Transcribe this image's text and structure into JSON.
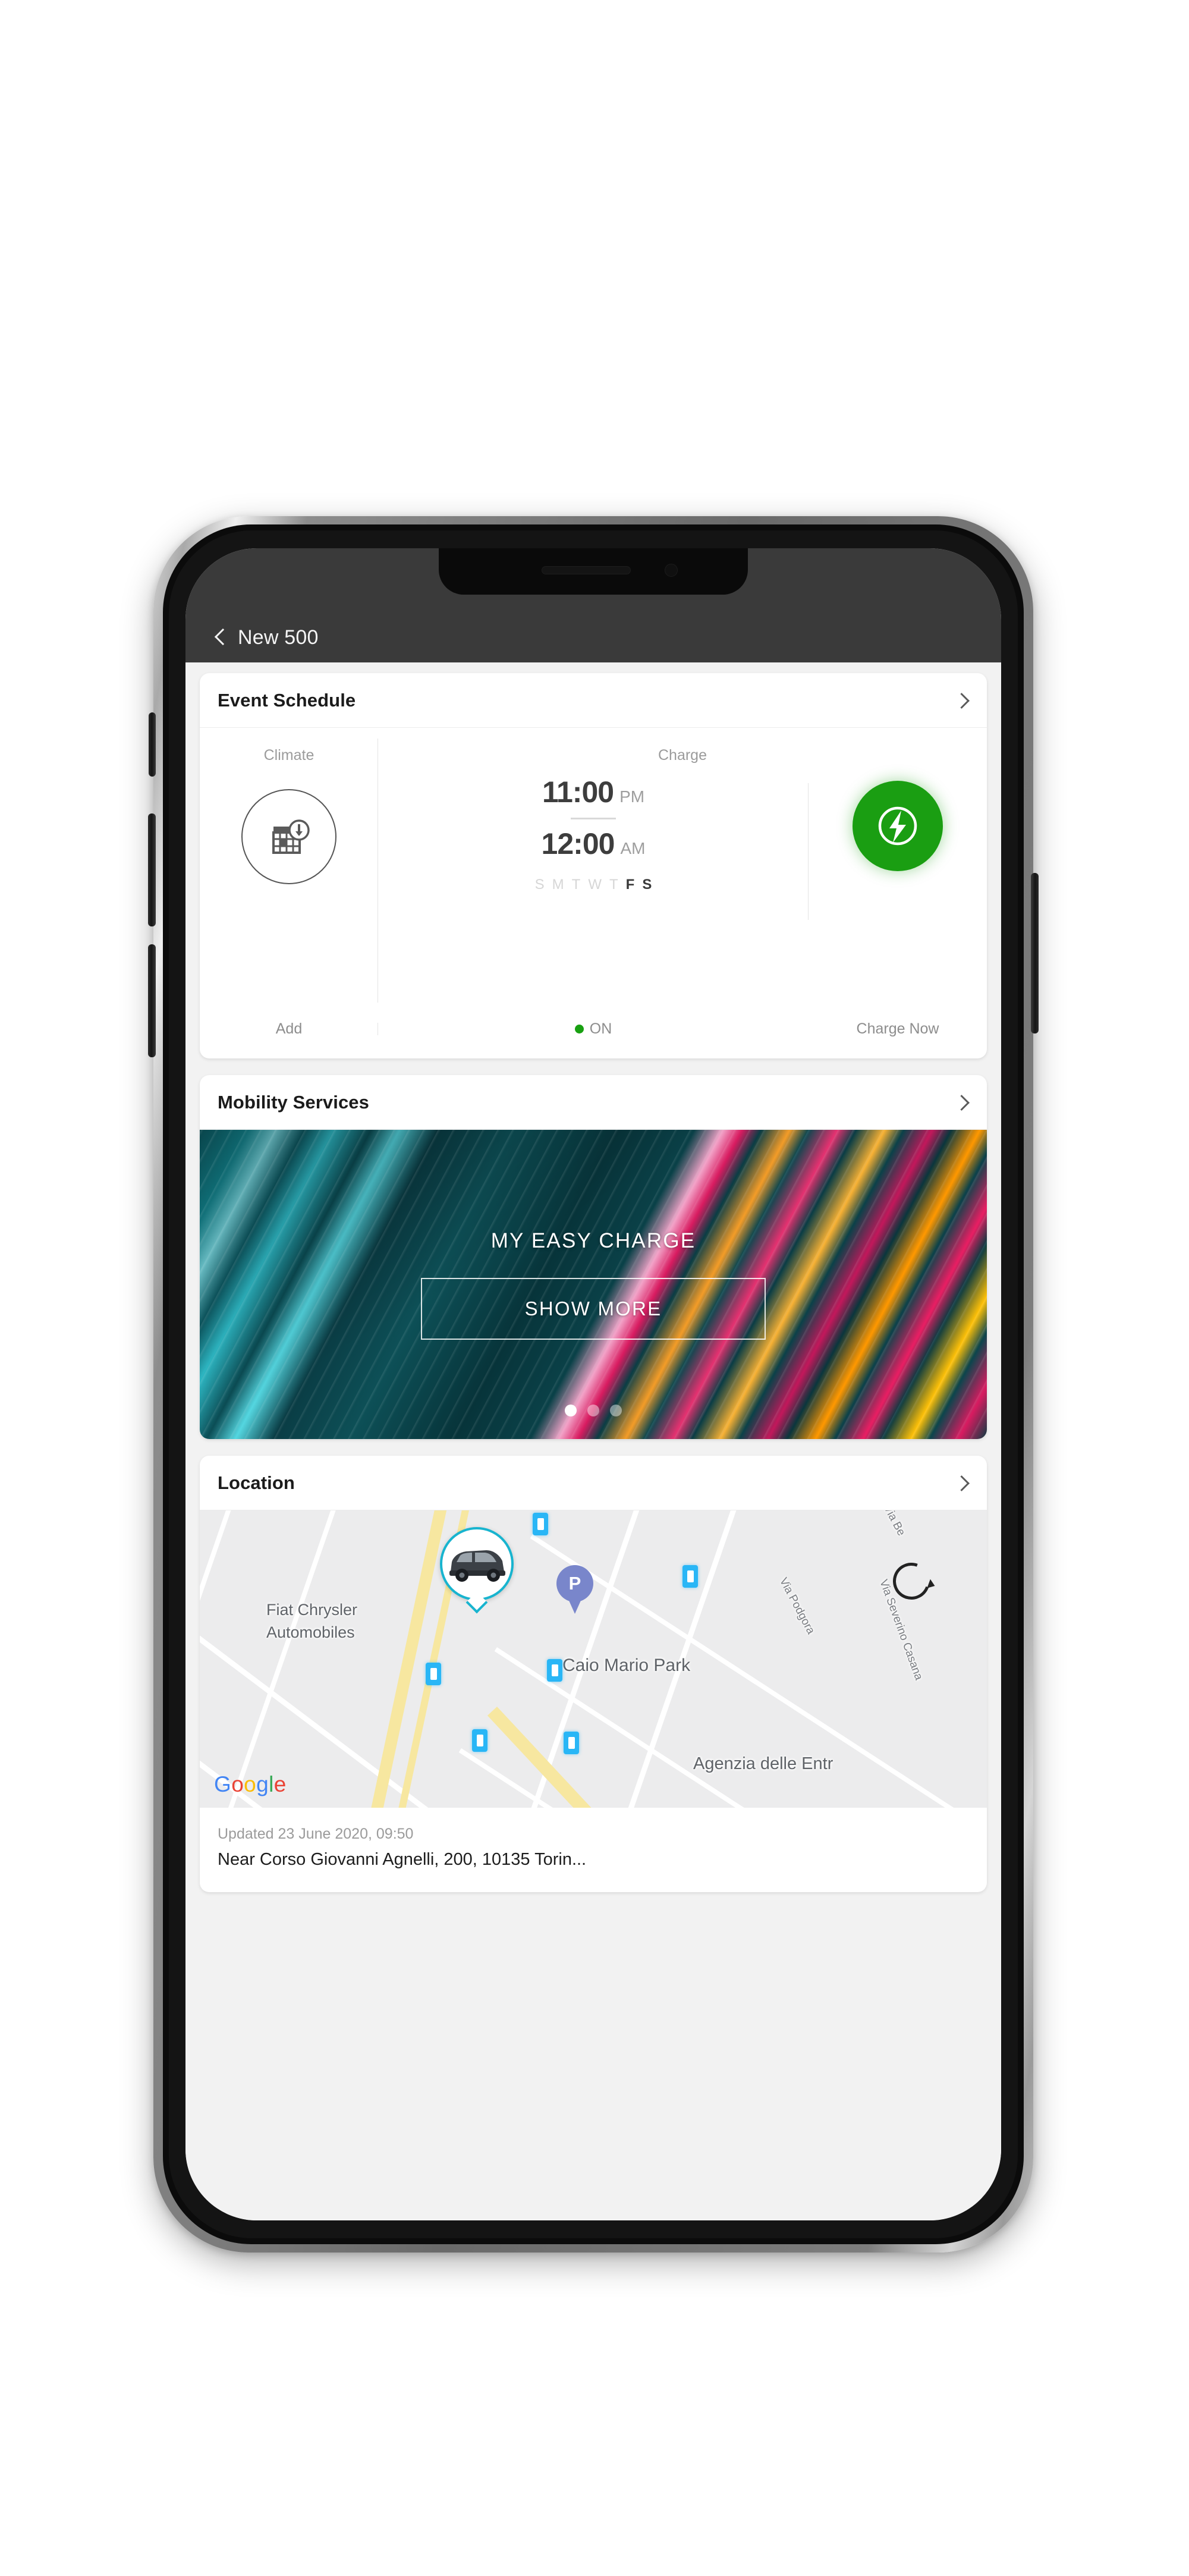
{
  "nav": {
    "back_icon": "chevron-left-icon",
    "title": "New 500"
  },
  "event_schedule": {
    "title": "Event Schedule",
    "chevron_icon": "chevron-right-icon",
    "climate": {
      "caption": "Climate",
      "icon": "calendar-clock-icon",
      "action_label": "Add"
    },
    "charge": {
      "caption": "Charge",
      "start_time": "11:00",
      "start_period": "PM",
      "end_time": "12:00",
      "end_period": "AM",
      "days": [
        {
          "label": "S",
          "active": false
        },
        {
          "label": "M",
          "active": false
        },
        {
          "label": "T",
          "active": false
        },
        {
          "label": "W",
          "active": false
        },
        {
          "label": "T",
          "active": false
        },
        {
          "label": "F",
          "active": true
        },
        {
          "label": "S",
          "active": true
        }
      ],
      "status_label": "ON",
      "status_color": "#18a011",
      "button_icon": "charge-bolt-icon",
      "button_color": "#1a9e12",
      "button_label": "Charge Now"
    }
  },
  "mobility_services": {
    "title": "Mobility Services",
    "chevron_icon": "chevron-right-icon",
    "banner": {
      "title": "MY EASY CHARGE",
      "cta_label": "SHOW MORE",
      "dots_total": 3,
      "dot_active_index": 0
    }
  },
  "location": {
    "title": "Location",
    "chevron_icon": "chevron-right-icon",
    "map": {
      "attribution": "Google",
      "attribution_letters": [
        "G",
        "o",
        "o",
        "g",
        "l",
        "e"
      ],
      "car_marker_icon": "car-location-pin-icon",
      "parking_pin_label": "P",
      "roundabout_icon": "roundabout-icon",
      "labels": [
        "Fiat Chrysler",
        "Automobiles",
        "Caio Mario Park",
        "Via Podgora",
        "Via Severino Casana",
        "Agenzia delle Entr",
        "Via Be"
      ]
    },
    "updated": "Updated 23 June 2020, 09:50",
    "address": "Near Corso Giovanni Agnelli, 200, 10135 Torin..."
  }
}
